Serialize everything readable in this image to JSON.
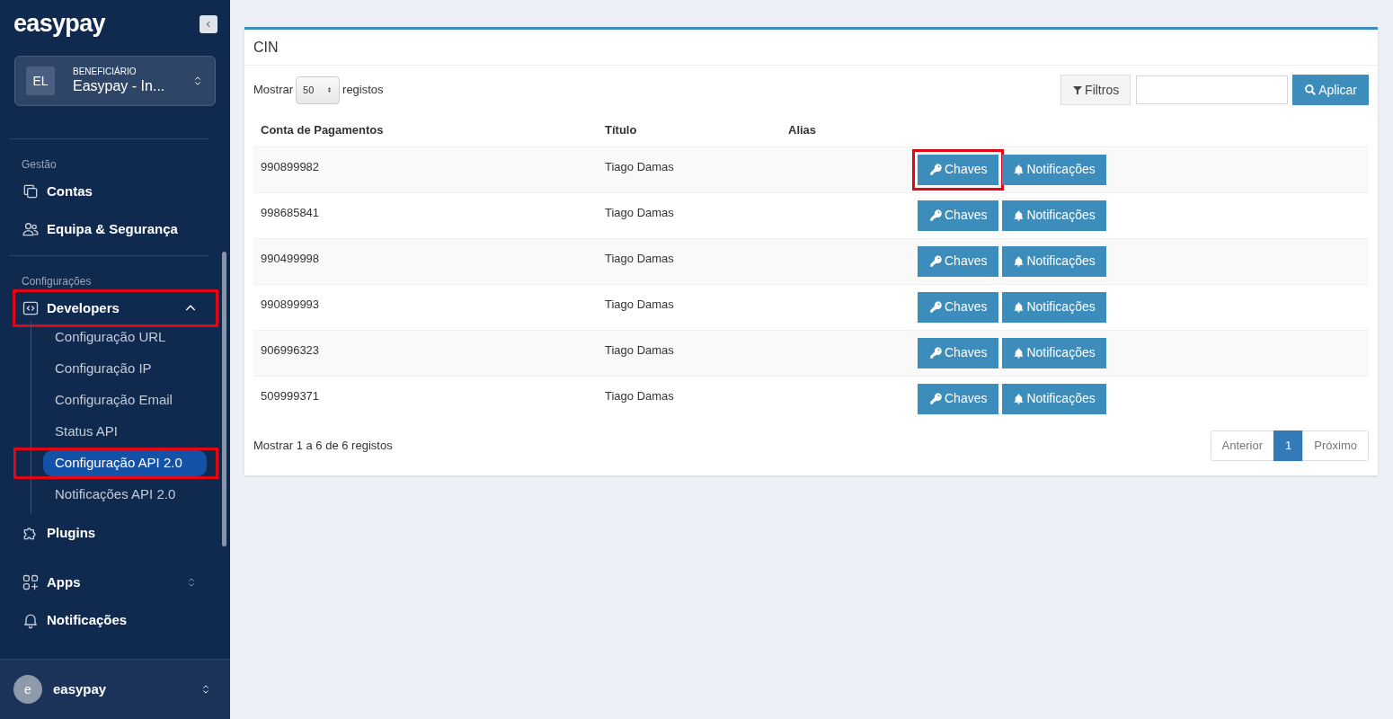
{
  "sidebar": {
    "logo": "easypay",
    "account": {
      "initials": "EL",
      "label": "BENEFICIÁRIO",
      "name": "Easypay - In..."
    },
    "sections": [
      {
        "heading": "Gestão",
        "items": [
          {
            "kind": "link",
            "label": "Contas",
            "highlighted": false
          },
          {
            "kind": "link",
            "label": "Equipa & Segurança",
            "highlighted": false
          }
        ]
      },
      {
        "heading": "Configurações",
        "items": [
          {
            "kind": "group",
            "label": "Developers",
            "expanded": true,
            "highlighted": true,
            "children": [
              {
                "label": "Configuração URL",
                "selected": false,
                "highlighted": false
              },
              {
                "label": "Configuração IP",
                "selected": false,
                "highlighted": false
              },
              {
                "label": "Configuração Email",
                "selected": false,
                "highlighted": false
              },
              {
                "label": "Status API",
                "selected": false,
                "highlighted": false
              },
              {
                "label": "Configuração API 2.0",
                "selected": true,
                "highlighted": true
              },
              {
                "label": "Notificações API 2.0",
                "selected": false,
                "highlighted": false
              }
            ]
          },
          {
            "kind": "link",
            "label": "Plugins",
            "highlighted": false
          },
          {
            "kind": "switcher",
            "label": "Apps",
            "highlighted": false
          },
          {
            "kind": "link",
            "label": "Notificações",
            "highlighted": false
          }
        ]
      }
    ],
    "user": {
      "avatar": "e",
      "name": "easypay"
    }
  },
  "panel": {
    "title": "CIN",
    "length": {
      "before": "Mostrar",
      "value": "50",
      "after": "registos"
    },
    "filter_button": "Filtros",
    "apply_button": "Aplicar",
    "table": {
      "columns": [
        "Conta de Pagamentos",
        "Título",
        "Alias"
      ],
      "rows": [
        {
          "account": "990899982",
          "title": "Tiago Damas",
          "actions": [
            {
              "kind": "keys",
              "label": "Chaves",
              "highlighted": true
            },
            {
              "kind": "notifications",
              "label": "Notificações",
              "highlighted": false
            }
          ]
        },
        {
          "account": "998685841",
          "title": "Tiago Damas",
          "actions": [
            {
              "kind": "keys",
              "label": "Chaves",
              "highlighted": false
            },
            {
              "kind": "notifications",
              "label": "Notificações",
              "highlighted": false
            }
          ]
        },
        {
          "account": "990499998",
          "title": "Tiago Damas",
          "actions": [
            {
              "kind": "keys",
              "label": "Chaves",
              "highlighted": false
            },
            {
              "kind": "notifications",
              "label": "Notificações",
              "highlighted": false
            }
          ]
        },
        {
          "account": "990899993",
          "title": "Tiago Damas",
          "actions": [
            {
              "kind": "keys",
              "label": "Chaves",
              "highlighted": false
            },
            {
              "kind": "notifications",
              "label": "Notificações",
              "highlighted": false
            }
          ]
        },
        {
          "account": "906996323",
          "title": "Tiago Damas",
          "actions": [
            {
              "kind": "keys",
              "label": "Chaves",
              "highlighted": false
            },
            {
              "kind": "notifications",
              "label": "Notificações",
              "highlighted": false
            }
          ]
        },
        {
          "account": "509999371",
          "title": "Tiago Damas",
          "actions": [
            {
              "kind": "keys",
              "label": "Chaves",
              "highlighted": false
            },
            {
              "kind": "notifications",
              "label": "Notificações",
              "highlighted": false
            }
          ]
        }
      ]
    },
    "info": "Mostrar 1 a 6 de 6 registos",
    "pagination": [
      {
        "label": "Anterior",
        "selected": false
      },
      {
        "label": "1",
        "selected": true
      },
      {
        "label": "Próximo",
        "selected": false
      }
    ]
  }
}
